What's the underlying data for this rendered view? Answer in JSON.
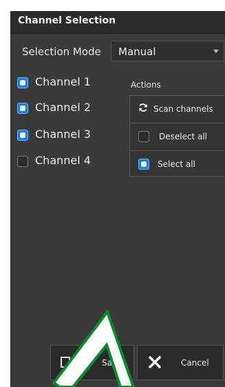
{
  "panel": {
    "title": "Channel Selection",
    "selection_mode_label": "Selection Mode",
    "selection_mode_value": "Manual"
  },
  "channels": [
    {
      "label": "Channel 1",
      "checked": true
    },
    {
      "label": "Channel 2",
      "checked": true
    },
    {
      "label": "Channel 3",
      "checked": true
    },
    {
      "label": "Channel 4",
      "checked": false
    }
  ],
  "actions": {
    "title": "Actions",
    "scan_label": "Scan channels",
    "deselect_label": "Deselect all",
    "select_label": "Select all",
    "select_all_checked": true,
    "deselect_all_checked": false
  },
  "footer": {
    "save_label": "Save",
    "cancel_label": "Cancel"
  },
  "colors": {
    "panel_bg": "#3a3a3a",
    "checkbox_blue": "#1c7ae0",
    "arrow_green": "#0a8a2d"
  }
}
